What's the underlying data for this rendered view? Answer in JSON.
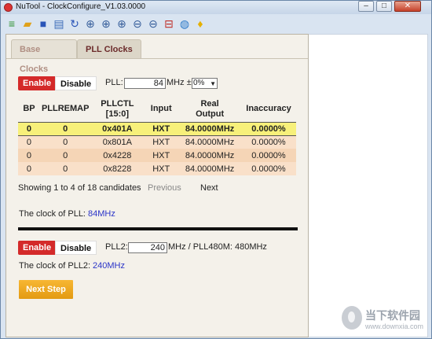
{
  "window": {
    "title": "NuTool - ClockConfigure_V1.03.0000"
  },
  "toolbar_icons": [
    "bars-icon",
    "folder-open-icon",
    "save-icon",
    "document-icon",
    "refresh-icon",
    "zoom-in-icon",
    "zoom-in-icon",
    "zoom-in-icon",
    "zoom-out-icon",
    "zoom-out-icon",
    "minus-icon",
    "globe-icon",
    "lightbulb-icon"
  ],
  "tabs": [
    {
      "label": "Base Clocks",
      "active": false
    },
    {
      "label": "PLL Clocks",
      "active": true
    }
  ],
  "pll": {
    "enable_label": "Enable",
    "disable_label": "Disable",
    "pll_label": "PLL:",
    "freq_value": "84",
    "unit_label": "MHz ±",
    "tolerance": "0%"
  },
  "table": {
    "headers": [
      "BP",
      "PLLREMAP",
      "PLLCTL\n[15:0]",
      "Input",
      "Real\nOutput",
      "Inaccuracy"
    ],
    "rows": [
      [
        "0",
        "0",
        "0x401A",
        "HXT",
        "84.0000MHz",
        "0.0000%"
      ],
      [
        "0",
        "0",
        "0x801A",
        "HXT",
        "84.0000MHz",
        "0.0000%"
      ],
      [
        "0",
        "0",
        "0x4228",
        "HXT",
        "84.0000MHz",
        "0.0000%"
      ],
      [
        "0",
        "0",
        "0x8228",
        "HXT",
        "84.0000MHz",
        "0.0000%"
      ]
    ]
  },
  "pager": {
    "summary": "Showing 1 to 4 of 18 candidates",
    "previous": "Previous",
    "next": "Next"
  },
  "pll_clock": {
    "label": "The clock of PLL:",
    "value": "84MHz"
  },
  "pll2": {
    "enable_label": "Enable",
    "disable_label": "Disable",
    "label": "PLL2:",
    "value": "240",
    "suffix": "MHz / PLL480M: 480MHz",
    "clock_label": "The clock of PLL2:",
    "clock_value": "240MHz"
  },
  "next_step_label": "Next Step",
  "watermark": {
    "text": "当下软件园",
    "sub": "www.downxia.com"
  }
}
